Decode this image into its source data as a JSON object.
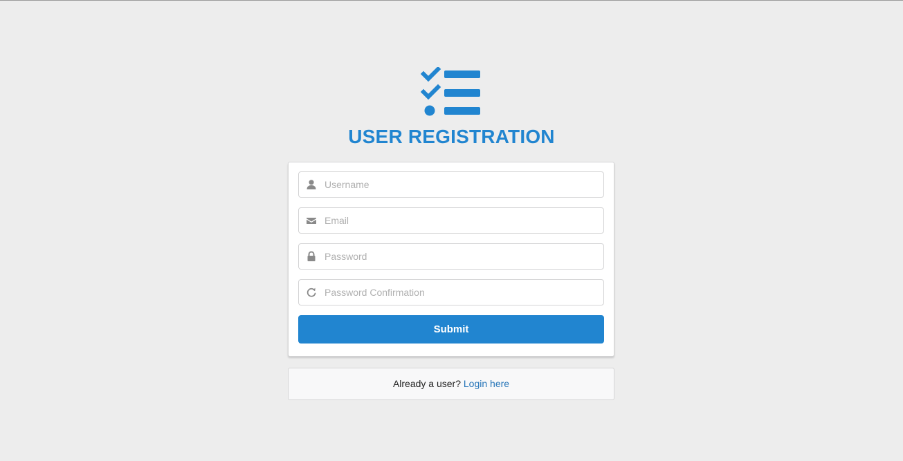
{
  "header": {
    "title": "USER REGISTRATION",
    "logo_icon": "tasks-checklist-icon",
    "accent_color": "#2185d0"
  },
  "form": {
    "fields": [
      {
        "name": "username",
        "icon": "user-icon",
        "placeholder": "Username",
        "value": ""
      },
      {
        "name": "email",
        "icon": "envelope-icon",
        "placeholder": "Email",
        "value": ""
      },
      {
        "name": "password",
        "icon": "lock-icon",
        "placeholder": "Password",
        "value": ""
      },
      {
        "name": "password_confirmation",
        "icon": "redo-icon",
        "placeholder": "Password Confirmation",
        "value": ""
      }
    ],
    "submit_label": "Submit"
  },
  "footer": {
    "prompt": "Already a user?",
    "link_label": "Login here"
  }
}
